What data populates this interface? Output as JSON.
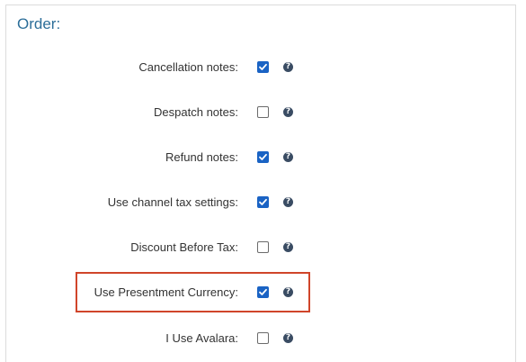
{
  "section": {
    "title": "Order:"
  },
  "settings": [
    {
      "label": "Cancellation notes:",
      "checked": true,
      "help": "?"
    },
    {
      "label": "Despatch notes:",
      "checked": false,
      "help": "?"
    },
    {
      "label": "Refund notes:",
      "checked": true,
      "help": "?"
    },
    {
      "label": "Use channel tax settings:",
      "checked": true,
      "help": "?"
    },
    {
      "label": "Discount Before Tax:",
      "checked": false,
      "help": "?"
    },
    {
      "label": "Use Presentment Currency:",
      "checked": true,
      "help": "?",
      "highlighted": true
    },
    {
      "label": "I Use Avalara:",
      "checked": false,
      "help": "?"
    }
  ],
  "colors": {
    "title": "#2c6e99",
    "checkbox_checked": "#1a63c4",
    "help_icon": "#3a4c63",
    "highlight_border": "#d0452a"
  }
}
